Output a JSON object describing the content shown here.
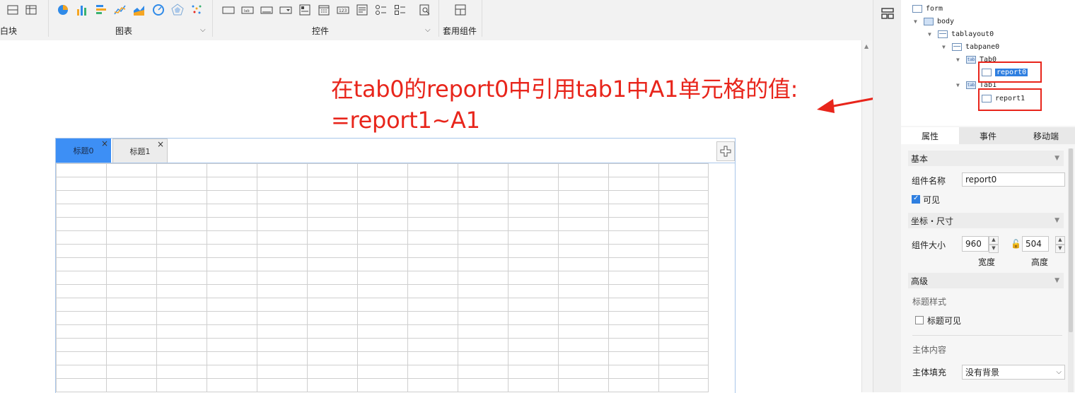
{
  "toolbar": {
    "groups": [
      {
        "label": "白块"
      },
      {
        "label": "图表"
      },
      {
        "label": "控件"
      },
      {
        "label": "套用组件"
      }
    ]
  },
  "annotation": {
    "line1": "在tab0的report0中引用tab1中A1单元格的值:",
    "line2": "=report1~A1",
    "color": "#e8251b"
  },
  "tabs": [
    {
      "label": "标题0",
      "close": "×",
      "active": true
    },
    {
      "label": "标题1",
      "close": "×",
      "active": false
    }
  ],
  "grid": {
    "columns": 13,
    "rows": 17
  },
  "tree": {
    "nodes": [
      {
        "label": "form"
      },
      {
        "label": "body"
      },
      {
        "label": "tablayout0"
      },
      {
        "label": "tabpane0"
      },
      {
        "label": "Tab0"
      },
      {
        "label": "report0",
        "selected": true
      },
      {
        "label": "Tab1"
      },
      {
        "label": "report1"
      }
    ]
  },
  "panel": {
    "tabs": [
      "属性",
      "事件",
      "移动端"
    ],
    "sections": {
      "basic": "基本",
      "coords": "坐标・尺寸",
      "advanced": "高级"
    },
    "component_name_label": "组件名称",
    "component_name_value": "report0",
    "visible_label": "可见",
    "visible_checked": true,
    "size_label": "组件大小",
    "width_value": "960",
    "height_value": "504",
    "width_caption": "宽度",
    "height_caption": "高度",
    "title_style_label": "标题样式",
    "title_visible_label": "标题可见",
    "title_visible_checked": false,
    "body_content_label": "主体内容",
    "body_fill_label": "主体填充",
    "body_fill_value": "没有背景"
  },
  "colors": {
    "accent": "#3d8ff5",
    "selection": "#2f7fe0",
    "annotation_red": "#e8251b"
  }
}
